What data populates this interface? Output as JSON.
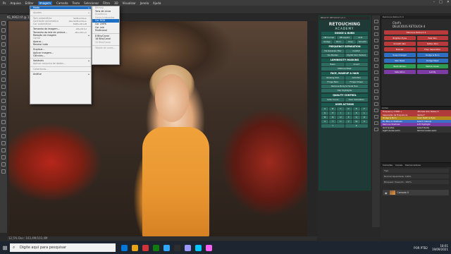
{
  "menubar": {
    "items": [
      "Arquivo",
      "Editar",
      "Imagem",
      "Camada",
      "Texto",
      "Selecionar",
      "Filtro",
      "3D",
      "Visualizar",
      "Janela",
      "Ajuda"
    ],
    "active_index": 2,
    "window_controls": [
      "–",
      "□",
      "✕"
    ]
  },
  "document_tab": "IMG_9902.tif @ 12,5% (RGB/8)",
  "status_bar": "12,5%   Doc: 103,4M/103,4M",
  "image_menu": {
    "items": [
      {
        "label": "Modo",
        "shortcut": "",
        "submenu": true,
        "selected": true
      },
      {
        "label": "",
        "separator": true
      },
      {
        "label": "Ajustes",
        "shortcut": "",
        "submenu": true,
        "dim": true
      },
      {
        "label": "",
        "separator": true
      },
      {
        "label": "Tom automático",
        "shortcut": "Shift+Ctrl+L",
        "dim": true
      },
      {
        "label": "Contraste automático",
        "shortcut": "Alt+Shift+Ctrl+L",
        "dim": true
      },
      {
        "label": "Cor automática",
        "shortcut": "Shift+Ctrl+B",
        "dim": true
      },
      {
        "label": "",
        "separator": true
      },
      {
        "label": "Tamanho da imagem...",
        "shortcut": "Alt+Ctrl+I"
      },
      {
        "label": "Tamanho da tela de pintura...",
        "shortcut": "Alt+Ctrl+C"
      },
      {
        "label": "Rotação da imagem",
        "shortcut": "",
        "submenu": true
      },
      {
        "label": "Cortar",
        "shortcut": "",
        "dim": true
      },
      {
        "label": "Aparar...",
        "shortcut": ""
      },
      {
        "label": "Revelar tudo",
        "shortcut": ""
      },
      {
        "label": "",
        "separator": true
      },
      {
        "label": "Duplicar...",
        "shortcut": ""
      },
      {
        "label": "Aplicar imagem...",
        "shortcut": ""
      },
      {
        "label": "Cálculos...",
        "shortcut": ""
      },
      {
        "label": "",
        "separator": true
      },
      {
        "label": "Variáveis",
        "shortcut": "",
        "submenu": true
      },
      {
        "label": "Aplicar conjunto de dados...",
        "shortcut": "",
        "dim": true
      },
      {
        "label": "",
        "separator": true
      },
      {
        "label": "Coberturas...",
        "shortcut": "",
        "dim": true
      },
      {
        "label": "",
        "separator": true
      },
      {
        "label": "Análise",
        "shortcut": "",
        "submenu": true
      }
    ]
  },
  "mode_submenu": {
    "items": [
      {
        "label": "Bitmap",
        "dim": true
      },
      {
        "label": "Tons de cinza"
      },
      {
        "label": "Duotônico",
        "dim": true
      },
      {
        "label": "Cores Indexadas",
        "dim": true
      },
      {
        "label": "Cor RGB",
        "highlight": true
      },
      {
        "label": "Cor CMYK"
      },
      {
        "label": "Cor Lab"
      },
      {
        "label": "Multicanal"
      },
      {
        "label": "",
        "separator": true
      },
      {
        "label": "8 Bits/Canal"
      },
      {
        "label": "16 Bits/Canal"
      },
      {
        "label": "32 Bits/Canal",
        "dim": true
      },
      {
        "label": "",
        "separator": true
      },
      {
        "label": "Tabela de cores...",
        "dim": true
      }
    ]
  },
  "plugin_panel": {
    "header": "BEAUTY RETOUCH v2.1",
    "logo_line1": "RETOUCHING",
    "logo_line2": "ACADEMY",
    "sections": [
      {
        "title": "DODGE & BURN",
        "rows": [
          [
            "DB Curves",
            "DB Layers",
            "Grid"
          ],
          [
            "Dodge",
            "Burn",
            "Grey",
            "Smooth"
          ]
        ]
      },
      {
        "title": "FREQUENCY SEPARATION",
        "rows": [
          [
            "Via Gaussian Blur",
            "Custom"
          ],
          [
            "Via Median",
            "Digital Skin Texture"
          ]
        ]
      },
      {
        "title": "LUMINOSITY MASKING",
        "rows": [
          [
            "Basic",
            "Invert"
          ],
          [
            "Midtone Mask"
          ]
        ]
      },
      {
        "title": "FACE, MAKEUP & HAIR",
        "rows": [
          [
            "Glowing Skin",
            "Anti-Pink"
          ],
          [
            "Fringe Bars",
            "Fringe Smear"
          ],
          [
            "Remove Body & Facial Hair"
          ],
          [
            "Hair Highlights"
          ]
        ]
      },
      {
        "title": "QUALITY CONTROL",
        "rows": [
          [
            "Solar Curve",
            "Over Saturation"
          ]
        ]
      },
      {
        "title": "USER ACTIONS",
        "rows": [
          [
            "A",
            "B",
            "C",
            "D",
            "E",
            "F"
          ],
          [
            "G",
            "H",
            "I",
            "J",
            "K",
            "L"
          ],
          [
            "M",
            "N",
            "O",
            "P",
            "Q",
            "R"
          ],
          [
            "S",
            "T",
            "U",
            "V",
            "W",
            "X"
          ],
          [
            "Y",
            "Z"
          ]
        ]
      }
    ]
  },
  "retouch_panel": {
    "header": "Delicious Retouch 4",
    "title_line1": "Chef's",
    "title_line2": "DELICIOUS RETOUCH 4",
    "buttons": [
      {
        "label": "Delicious Retouch 4",
        "color": "red",
        "wide": true
      },
      {
        "label": "Brighten Eyes",
        "color": "red"
      },
      {
        "label": "Pale Skin",
        "color": "red"
      },
      {
        "label": "Smooth Skin",
        "color": "red"
      },
      {
        "label": "Soften Skin",
        "color": "red"
      },
      {
        "label": "Bronzer",
        "color": "red"
      },
      {
        "label": "Freq. Separation",
        "color": "red"
      },
      {
        "label": "Soap Changer",
        "color": "blue"
      },
      {
        "label": "Dodge & Burn",
        "color": "blue"
      },
      {
        "label": "Skin Mask",
        "color": "blue"
      },
      {
        "label": "Dodge Mask",
        "color": "blue"
      },
      {
        "label": "Teeth Whiten",
        "color": "green"
      },
      {
        "label": "Mellow Green",
        "color": "green"
      },
      {
        "label": "Saturation",
        "color": "purple"
      },
      {
        "label": "Lumify",
        "color": "purple"
      }
    ]
  },
  "actions_panel": {
    "header": "Ações",
    "rows": [
      {
        "left": "Frequency 4 HDR +",
        "right": "Ultimate Skin Retouch",
        "color": "#b13a3a"
      },
      {
        "left": "Separação de Frequência",
        "right": "Darken*",
        "color": "#b13a3a"
      },
      {
        "left": "Dodge & Burn",
        "right": "Clear Teeth & Eyes",
        "color": "#b58a1c"
      },
      {
        "left": "Fix Blue in Shadows",
        "right": "Select makeup",
        "color": "#3a6fc5"
      },
      {
        "left": "Remove Shadows",
        "right": "Soft Highlight",
        "color": "#7a3aa3"
      },
      {
        "left": "Grid Guides",
        "right": "Select Darks",
        "color": "#333333"
      },
      {
        "left": "Light (Luzes sem)",
        "right": "Normal (Luzes sem)",
        "color": "#333333"
      }
    ]
  },
  "layers_panel": {
    "tabs": [
      "Camadas",
      "Canais",
      "Demarcadores"
    ],
    "filter_label": "Tipo",
    "blend_label": "Normal      Opacidade: 100%",
    "lock_label": "Bloquear:        Preench.: 100%",
    "layer_name": "Camada 0"
  },
  "taskbar": {
    "start_icon": "windows-icon",
    "search_placeholder": "Digite aqui para pesquisar",
    "apps": [
      "#0078d7",
      "#e8a317",
      "#d13438",
      "#107c10",
      "#31a8ff",
      "#2d2d2d",
      "#9999ff",
      "#00c8ff",
      "#ff61f6"
    ],
    "tray": {
      "lang": "POR PTB2",
      "time": "18:01",
      "date": "19/09/2021"
    }
  }
}
